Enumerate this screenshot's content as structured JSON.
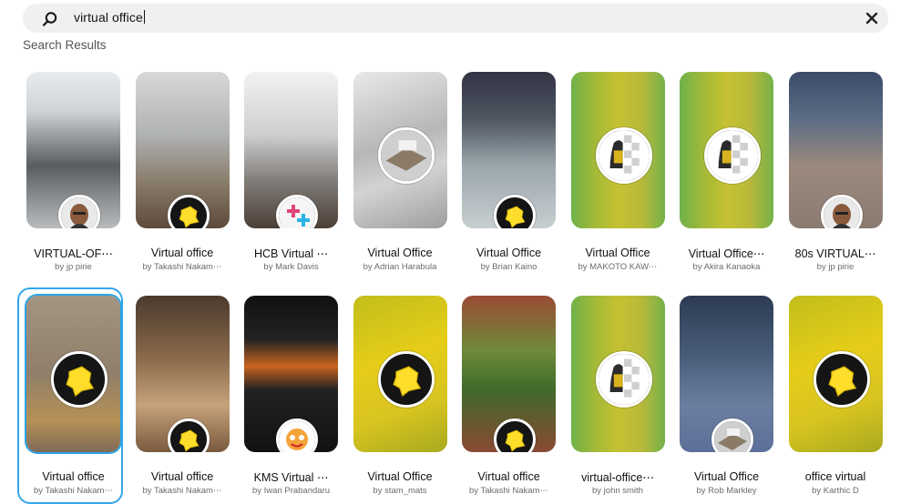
{
  "search": {
    "query": "virtual office",
    "icon": "search-icon",
    "clear_icon": "close-icon"
  },
  "section_title": "Search Results",
  "results": [
    {
      "title": "VIRTUAL-OF⋯",
      "author": "by jp pirie",
      "bg": "bg-office1",
      "avatar": "face"
    },
    {
      "title": "Virtual office",
      "author": "by Takashi Nakam⋯",
      "bg": "bg-livingroom",
      "avatar": "lens"
    },
    {
      "title": "HCB Virtual ⋯",
      "author": "by Mark Davis",
      "bg": "bg-loft",
      "avatar": "plus"
    },
    {
      "title": "Virtual Office",
      "author": "by Adrian Harabula",
      "bg": "bg-gray",
      "avatar": "room",
      "center": true
    },
    {
      "title": "Virtual Office",
      "author": "by Brian Kaino",
      "bg": "bg-lounge",
      "avatar": "lens"
    },
    {
      "title": "Virtual Office",
      "author": "by MAKOTO KAW⋯",
      "bg": "bg-greenyellow",
      "avatar": "checker",
      "center": true
    },
    {
      "title": "Virtual Office⋯",
      "author": "by Akira Kanaoka",
      "bg": "bg-greenyellow",
      "avatar": "checker",
      "center": true
    },
    {
      "title": "80s VIRTUAL⋯",
      "author": "by jp pirie",
      "bg": "bg-man",
      "avatar": "face"
    },
    {
      "title": "Virtual office",
      "author": "by Takashi Nakam⋯",
      "bg": "bg-tiles",
      "avatar": "lens",
      "center": true,
      "selected": true
    },
    {
      "title": "Virtual office",
      "author": "by Takashi Nakam⋯",
      "bg": "bg-wood",
      "avatar": "lens"
    },
    {
      "title": "KMS Virtual ⋯",
      "author": "by Iwan Prabandaru",
      "bg": "bg-kitchen",
      "avatar": "cartoon"
    },
    {
      "title": "Virtual Office",
      "author": "by stam_mats",
      "bg": "bg-yellow",
      "avatar": "lens",
      "center": true
    },
    {
      "title": "Virtual office",
      "author": "by Takashi Nakam⋯",
      "bg": "bg-ivy",
      "avatar": "lens"
    },
    {
      "title": "virtual-office⋯",
      "author": "by john smith",
      "bg": "bg-greenyellow",
      "avatar": "checker",
      "center": true
    },
    {
      "title": "Virtual Office",
      "author": "by Rob Markley",
      "bg": "bg-man2",
      "avatar": "room"
    },
    {
      "title": "office virtual",
      "author": "by Karthic D",
      "bg": "bg-yellow",
      "avatar": "lens",
      "center": true
    }
  ],
  "colors": {
    "selected_border": "#34a7ea",
    "lens_yellow": "#ffde2b",
    "search_bg": "#f0f0f0"
  }
}
